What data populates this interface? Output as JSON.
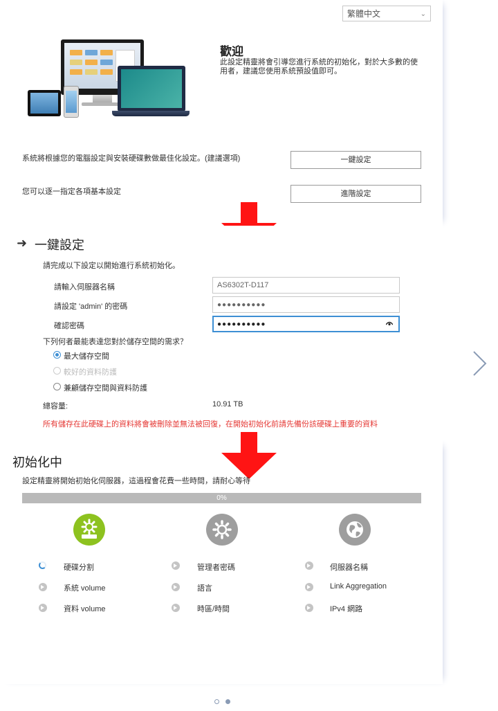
{
  "language": {
    "selected": "繁體中文"
  },
  "welcome": {
    "title": "歡迎",
    "text": "此設定精靈將會引導您進行系統的初始化，對於大多數的使用者，建議您使用系統預設值即可。",
    "option1_text": "系統將根據您的電腦設定與安裝硬碟數做最佳化設定。(建議選項)",
    "option1_button": "一鍵設定",
    "option2_text": "您可以逐一指定各項基本設定",
    "option2_button": "進階設定"
  },
  "one_click": {
    "title": "一鍵設定",
    "instruction": "請完成以下設定以開始進行系統初始化。",
    "server_name_label": "請輸入伺服器名稱",
    "server_name_value": "AS6302T-D117",
    "admin_pw_label": "請設定 'admin' 的密碼",
    "admin_pw_value": "●●●●●●●●●●",
    "confirm_pw_label": "確認密碼",
    "confirm_pw_value": "●●●●●●●●●●",
    "storage_question": "下列何者最能表達您對於儲存空間的需求？",
    "storage_options": [
      {
        "label": "最大儲存空間",
        "state": "selected"
      },
      {
        "label": "較好的資料防護",
        "state": "disabled"
      },
      {
        "label": "兼顧儲存空間與資料防護",
        "state": "unselected"
      }
    ],
    "capacity_label": "總容量:",
    "capacity_value": "10.91 TB",
    "warning": "所有儲存在此硬碟上的資料將會被刪除並無法被回復，在開始初始化前請先備份該硬碟上重要的資料"
  },
  "init": {
    "title": "初始化中",
    "desc": "設定精靈將開始初始化伺服器，這過程會花費一些時間，請耐心等待",
    "progress": 0,
    "progress_text": "0%",
    "steps": [
      {
        "icon": "gear-disk-icon",
        "color": "#8dc21f"
      },
      {
        "icon": "gear-icon",
        "color": "#9e9e9e"
      },
      {
        "icon": "globe-icon",
        "color": "#9e9e9e"
      }
    ],
    "tasks": [
      {
        "label": "硬碟分割",
        "state": "in-progress"
      },
      {
        "label": "管理者密碼",
        "state": "pending"
      },
      {
        "label": "伺服器名稱",
        "state": "pending"
      },
      {
        "label": "系統 volume",
        "state": "pending"
      },
      {
        "label": "語言",
        "state": "pending"
      },
      {
        "label": "Link Aggregation",
        "state": "pending"
      },
      {
        "label": "資料 volume",
        "state": "pending"
      },
      {
        "label": "時區/時間",
        "state": "pending"
      },
      {
        "label": "IPv4 網路",
        "state": "pending"
      }
    ]
  },
  "colors": {
    "accent": "#3d8fd4",
    "arrow": "#ff1414",
    "warning": "#e53935",
    "step_active": "#8dc21f",
    "step_inactive": "#9e9e9e"
  },
  "pager": {
    "total": 2,
    "current": 2
  }
}
